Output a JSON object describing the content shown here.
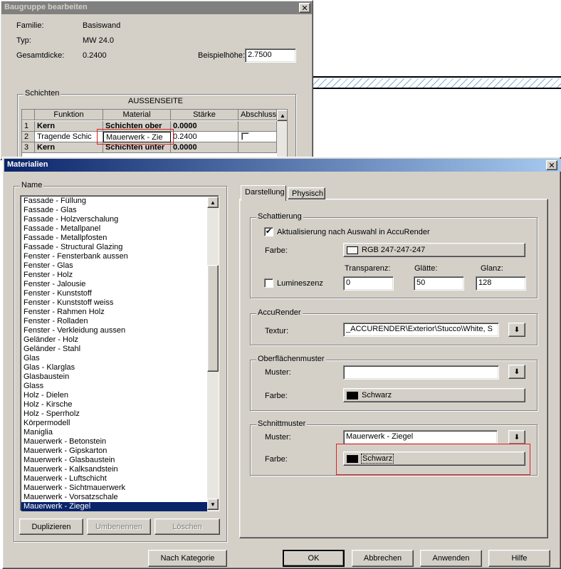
{
  "bg_window": {
    "title": "Baugruppe bearbeiten",
    "close_label": "✕",
    "family_label": "Familie:",
    "family_value": "Basiswand",
    "type_label": "Typ:",
    "type_value": "MW 24.0",
    "thickness_label": "Gesamtdicke:",
    "thickness_value": "0.2400",
    "sample_height_label": "Beispielhöhe:",
    "sample_height_value": "2.7500",
    "layers_group": "Schichten",
    "outside_label": "AUSSENSEITE",
    "columns": [
      "Funktion",
      "Material",
      "Stärke",
      "Abschluss"
    ],
    "rows": [
      {
        "num": "1",
        "function": "Kern",
        "material": "Schichten ober",
        "thickness": "0.0000"
      },
      {
        "num": "2",
        "function": "Tragende Schic",
        "material": "Mauerwerk - Zie",
        "thickness": "0.2400"
      },
      {
        "num": "3",
        "function": "Kern",
        "material": "Schichten unter",
        "thickness": "0.0000"
      }
    ]
  },
  "dialog": {
    "title": "Materialien",
    "close_label": "✕",
    "name_group": "Name",
    "materials": [
      "Fassade - Füllung",
      "Fassade - Glas",
      "Fassade - Holzverschalung",
      "Fassade - Metallpanel",
      "Fassade - Metallpfosten",
      "Fassade - Structural Glazing",
      "Fenster - Fensterbank aussen",
      "Fenster - Glas",
      "Fenster - Holz",
      "Fenster - Jalousie",
      "Fenster - Kunststoff",
      "Fenster - Kunststoff weiss",
      "Fenster - Rahmen Holz",
      "Fenster - Rolladen",
      "Fenster - Verkleidung aussen",
      "Geländer - Holz",
      "Geländer - Stahl",
      "Glas",
      "Glas - Klarglas",
      "Glasbaustein",
      "Glass",
      "Holz - Dielen",
      "Holz - Kirsche",
      "Holz - Sperrholz",
      "Körpermodell",
      "Maniglia",
      "Mauerwerk - Betonstein",
      "Mauerwerk - Gipskarton",
      "Mauerwerk - Glasbaustein",
      "Mauerwerk - Kalksandstein",
      "Mauerwerk - Luftschicht",
      "Mauerwerk - Sichtmauerwerk",
      "Mauerwerk - Vorsatzschale",
      "Mauerwerk - Ziegel"
    ],
    "selected_material": "Mauerwerk - Ziegel",
    "buttons": {
      "duplicate": "Duplizieren",
      "rename": "Umbenennen",
      "delete": "Löschen",
      "by_category": "Nach Kategorie",
      "ok": "OK",
      "cancel": "Abbrechen",
      "apply": "Anwenden",
      "help": "Hilfe"
    },
    "tabs": {
      "display": "Darstellung",
      "physical": "Physisch"
    },
    "shading": {
      "group": "Schattierung",
      "update_checkbox_label": "Aktualisierung nach Auswahl in AccuRender",
      "update_checked": true,
      "color_label": "Farbe:",
      "color_value": "RGB 247-247-247",
      "color_hex": "#f7f7f7",
      "transparency_label": "Transparenz:",
      "smoothness_label": "Glätte:",
      "gloss_label": "Glanz:",
      "luminescence_label": "Lumineszenz",
      "luminescence_checked": false,
      "transparency_value": "0",
      "smoothness_value": "50",
      "gloss_value": "128"
    },
    "accurender": {
      "group": "AccuRender",
      "texture_label": "Textur:",
      "texture_value": "_ACCURENDER\\Exterior\\Stucco\\White, S"
    },
    "surface_pattern": {
      "group": "Oberflächenmuster",
      "pattern_label": "Muster:",
      "pattern_value": "",
      "color_label": "Farbe:",
      "color_value": "Schwarz",
      "color_hex": "#000000"
    },
    "cut_pattern": {
      "group": "Schnittmuster",
      "pattern_label": "Muster:",
      "pattern_value": "Mauerwerk - Ziegel",
      "color_label": "Farbe:",
      "color_value": "Schwarz",
      "color_hex": "#000000"
    }
  },
  "colors": {
    "face": "#d4d0c8",
    "active_title": "#0a246a",
    "inactive_title": "#808080",
    "selection": "#0a246a",
    "annotation_red": "#e02020"
  }
}
